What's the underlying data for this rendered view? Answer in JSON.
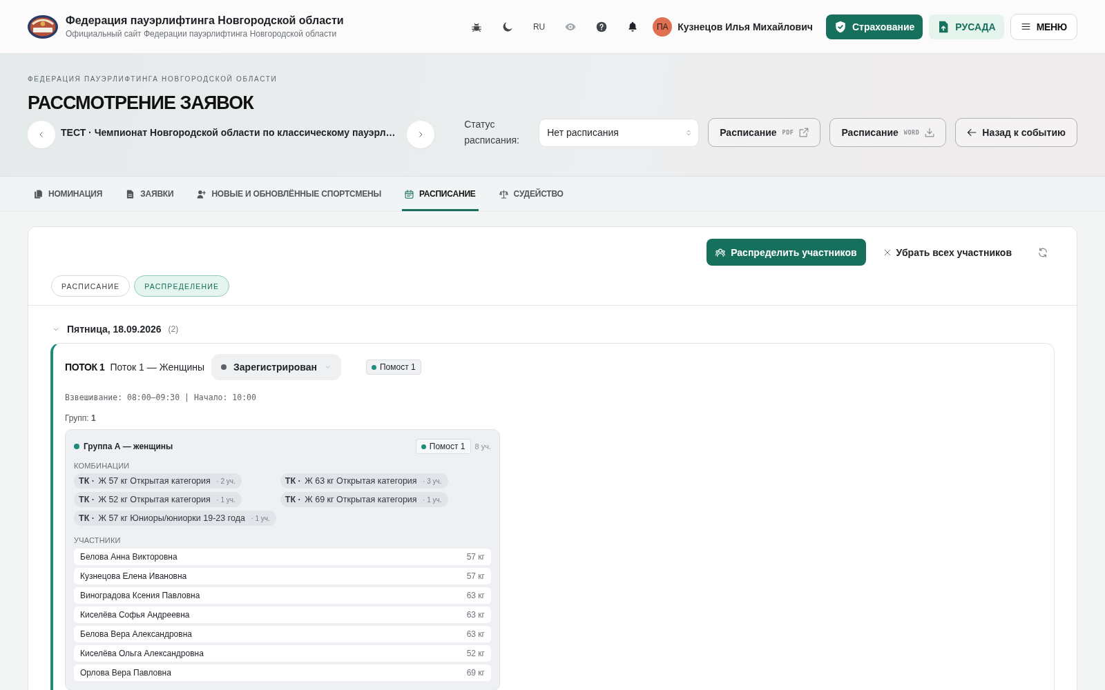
{
  "header": {
    "title": "Федерация пауэрлифтинга Новгородской области",
    "subtitle": "Официальный сайт Федерации пауэрлифтинга Новгородской области",
    "language": "RU",
    "user": {
      "initials": "ПА",
      "name": "Кузнецов Илья Михайлович"
    },
    "buttons": [
      {
        "kind": "primary",
        "label": "Страхование"
      },
      {
        "kind": "soft",
        "label": "РУСАДА"
      },
      {
        "kind": "menu",
        "label": "МЕНЮ"
      }
    ]
  },
  "banner": {
    "eyebrow": "ФЕДЕРАЦИЯ ПАУЭРЛИФТИНГА НОВГОРОДСКОЙ ОБЛАСТИ",
    "title": "РАССМОТРЕНИЕ ЗАЯВОК",
    "event": "ТЕСТ · Чемпионат Новгородской области по классическому пауэрл…",
    "status_label": "Статус расписания:",
    "status_select": {
      "value": "Нет расписания"
    },
    "actions": [
      {
        "kind": "external",
        "label": "Расписание",
        "tag": "PDF"
      },
      {
        "kind": "download",
        "label": "Расписание",
        "tag": "WORD"
      },
      {
        "kind": "back",
        "label": "Назад к событию"
      }
    ]
  },
  "tabs": [
    {
      "label": "НОМИНАЦИЯ",
      "selected": false
    },
    {
      "label": "ЗАЯВКИ",
      "selected": false
    },
    {
      "label": "НОВЫЕ И ОБНОВЛЁННЫЕ СПОРТСМЕНЫ",
      "selected": false
    },
    {
      "label": "РАСПИСАНИЕ",
      "selected": true
    },
    {
      "label": "СУДЕЙСТВО",
      "selected": false
    }
  ],
  "panel": {
    "actions": [
      {
        "kind": "distribute",
        "label": "Распределить участников"
      },
      {
        "kind": "clear",
        "label": "Убрать всех участников"
      }
    ],
    "view_tabs": [
      {
        "label": "РАСПИСАНИЕ",
        "selected": false
      },
      {
        "label": "РАСПРЕДЕЛЕНИЕ",
        "selected": true
      }
    ],
    "days": [
      {
        "title": "Пятница, 18.09.2026",
        "count": "(2)",
        "expanded": true,
        "streams": [
          {
            "code": "ПОТОК 1",
            "name": "Поток 1 — Женщины",
            "status": "Зарегистрирован",
            "platform": "Помост 1",
            "timing": "Взвешивание: 08:00–09:30 | Начало: 10:00",
            "groups_label": "Групп: **1**",
            "groups": [
              {
                "name": "Группа А — женщины",
                "platform": "Помост 1",
                "count": "8 уч.",
                "combinations_label": "КОМБИНАЦИИ",
                "combinations": [
                  {
                    "code": "ТК ·",
                    "label": "Ж 57 кг Открытая категория",
                    "count": "· 2 уч."
                  },
                  {
                    "code": "ТК ·",
                    "label": "Ж 63 кг Открытая категория",
                    "count": "· 3 уч."
                  },
                  {
                    "code": "ТК ·",
                    "label": "Ж 52 кг Открытая категория",
                    "count": "· 1 уч."
                  },
                  {
                    "code": "ТК ·",
                    "label": "Ж 69 кг Открытая категория",
                    "count": "· 1 уч."
                  },
                  {
                    "code": "ТК ·",
                    "label": "Ж 57 кг Юниоры/юниорки 19-23 года",
                    "count": "· 1 уч."
                  }
                ],
                "participants_label": "УЧАСТНИКИ",
                "participants": [
                  {
                    "name": "Белова Анна Викторовна",
                    "weight": "57 кг"
                  },
                  {
                    "name": "Кузнецова Елена Ивановна",
                    "weight": "57 кг"
                  },
                  {
                    "name": "Виноградова Ксения Павловна",
                    "weight": "63 кг"
                  },
                  {
                    "name": "Киселёва Софья Андреевна",
                    "weight": "63 кг"
                  },
                  {
                    "name": "Белова Вера Александровна",
                    "weight": "63 кг"
                  },
                  {
                    "name": "Киселёва Ольга Александровна",
                    "weight": "52 кг"
                  },
                  {
                    "name": "Орлова Вера Павловна",
                    "weight": "69 кг"
                  }
                ]
              }
            ]
          }
        ]
      }
    ]
  }
}
